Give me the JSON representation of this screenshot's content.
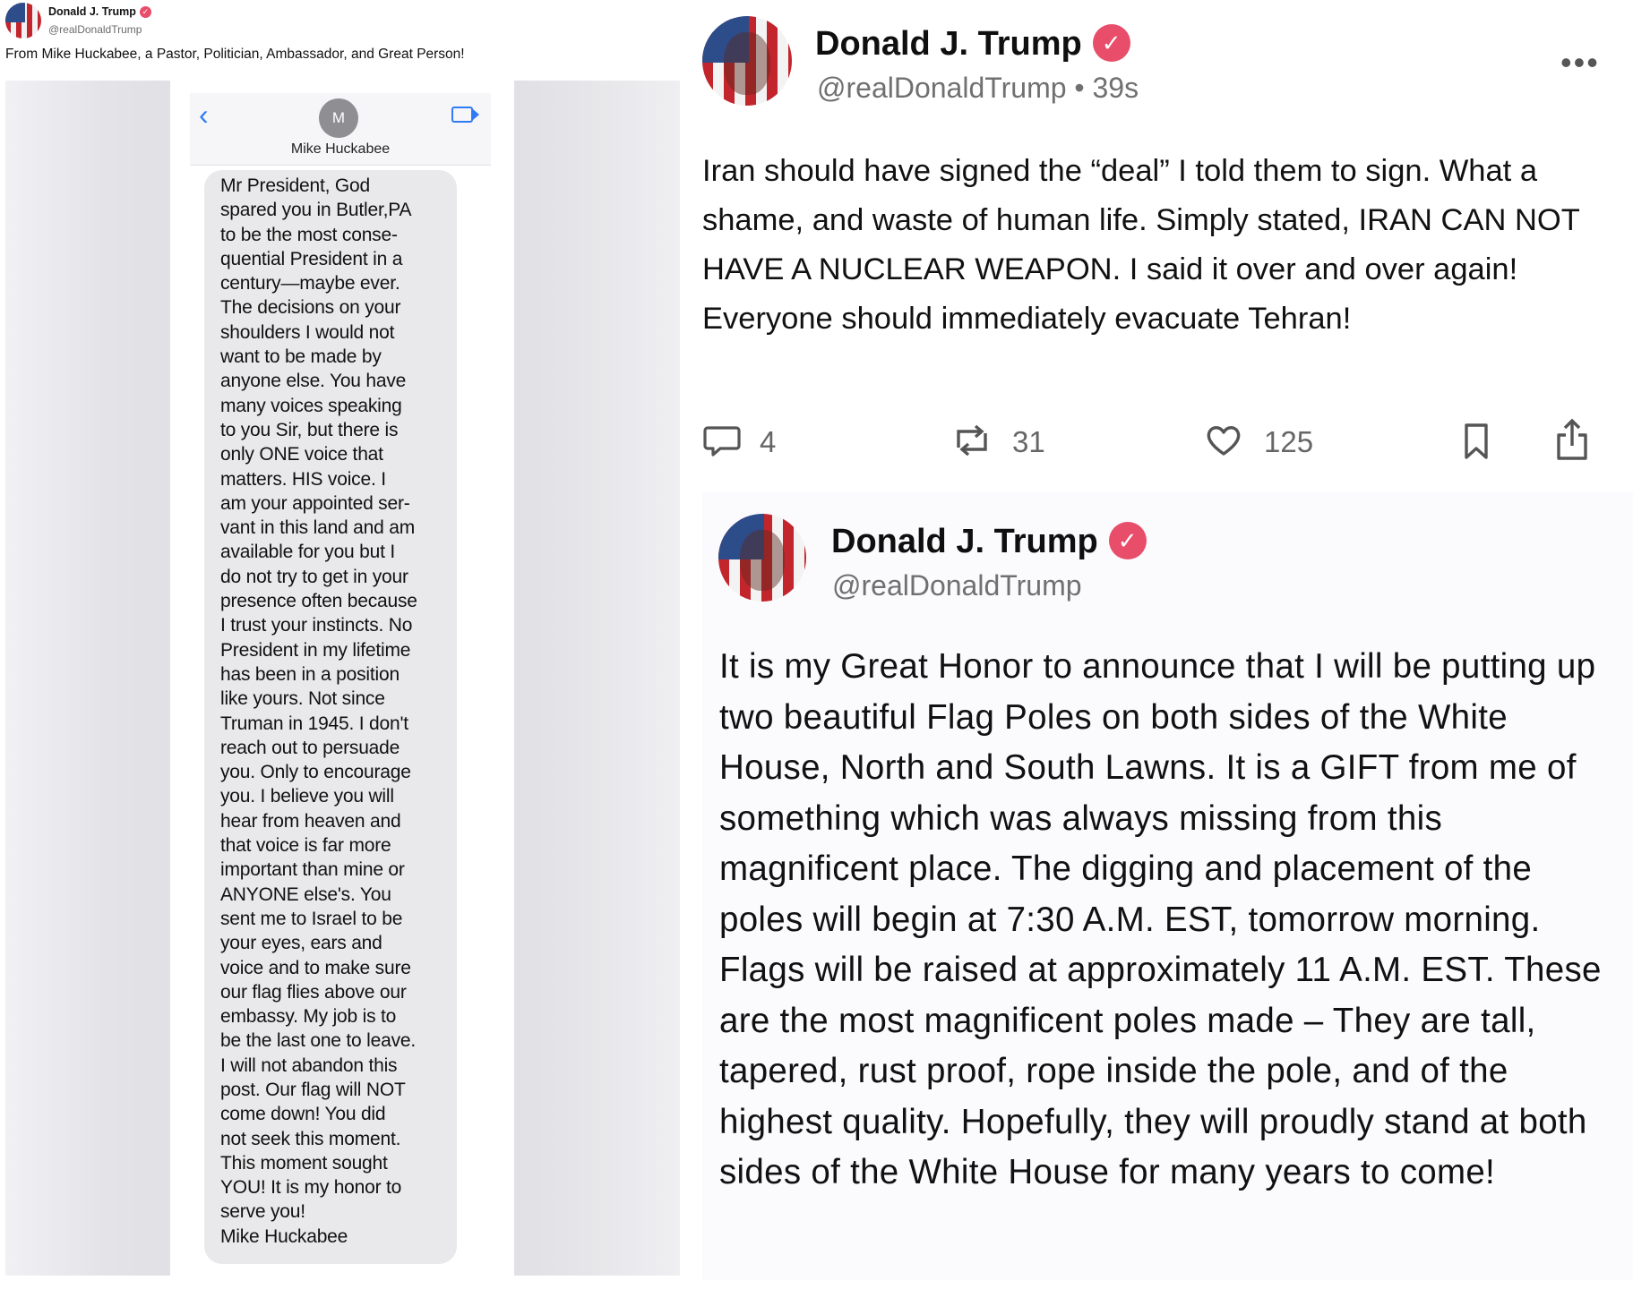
{
  "left_post": {
    "author_name": "Donald J. Trump",
    "author_handle": "@realDonaldTrump",
    "caption": "From Mike Huckabee, a Pastor, Politician, Ambassador, and Great Person!",
    "contact_name": "Mike Huckabee",
    "contact_initial": "M",
    "message": "Mr President, God\nspared you in Butler,PA\nto be the most conse-\nquential President in a\ncentury—maybe ever.\nThe decisions on your\nshoulders I would not\nwant to be made by\nanyone else.  You have\nmany voices speaking\nto you Sir, but there is\nonly ONE voice that\nmatters.  HIS voice.  I\nam your appointed ser-\nvant in this land and am\navailable for you but I\ndo not try to get in your\npresence often because\nI trust your instincts.  No\nPresident in my lifetime\nhas been in a position\nlike yours.  Not since\nTruman in 1945.  I don't\nreach out to persuade\nyou.  Only to encourage\nyou. I believe you will\nhear from heaven and\nthat voice is far more\nimportant than mine or\nANYONE else's.  You\nsent me to Israel to be\nyour eyes, ears and\nvoice and to make sure\nour flag flies above our\nembassy.  My job is to\nbe the last one to leave.\nI will not abandon this\npost. Our flag will NOT\ncome down!  You did\nnot seek this moment.\nThis moment sought\nYOU! It is my honor to\nserve you!\nMike Huckabee"
  },
  "post1": {
    "author_name": "Donald J. Trump",
    "handle_time": "@realDonaldTrump • 39s",
    "text": "Iran should have signed the “deal” I told them to sign. What a shame, and waste of human life. Simply stated, IRAN CAN NOT HAVE A NUCLEAR WEAPON. I said it over and over again! Everyone should immediately evacuate Tehran!",
    "replies": "4",
    "reposts": "31",
    "likes": "125"
  },
  "post2": {
    "author_name": "Donald J. Trump",
    "handle": "@realDonaldTrump",
    "text": "It is my Great Honor to announce that I will be putting up two beautiful Flag Poles on both sides of the White House, North and South Lawns. It is a GIFT from me of something which was always missing from this magnificent place. The digging and placement of the poles will begin at 7:30 A.M. EST, tomorrow morning. Flags will be raised at approximately 11 A.M. EST. These are the most magnificent poles made – They are tall, tapered, rust proof, rope inside the pole, and of the highest quality. Hopefully, they will proudly stand at both sides of the White House for many years to come!"
  },
  "colors": {
    "verified_badge": "#e84d6a",
    "imessage_blue": "#2f7bf5",
    "bubble_gray": "#e9e9eb"
  },
  "icons": {
    "reply": "reply-icon",
    "repost": "repost-icon",
    "like": "heart-icon",
    "bookmark": "bookmark-icon",
    "share": "share-icon"
  }
}
